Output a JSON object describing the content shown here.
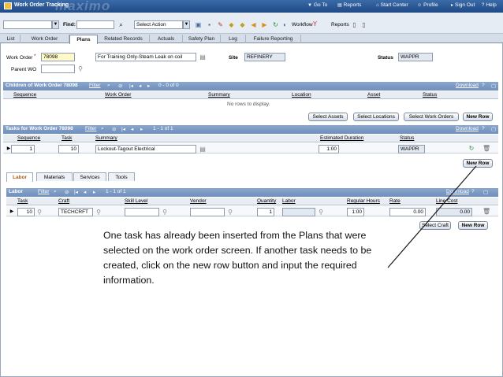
{
  "app": {
    "title": "Work Order Tracking",
    "logo": "maximo",
    "nav": [
      "Go To",
      "Reports",
      "Start Center",
      "Profile",
      "Sign Out",
      "Help"
    ]
  },
  "toolbar": {
    "find_label": "Find:",
    "select_action": "Select Action",
    "workflow_label": "Workflow",
    "reports_label": "Reports"
  },
  "tabs": [
    "List",
    "Work Order",
    "Plans",
    "Related Records",
    "Actuals",
    "Safety Plan",
    "Log",
    "Failure Reporting"
  ],
  "header": {
    "work_order_label": "Work Order",
    "work_order_value": "78098",
    "description": "For Training Only-Steam Leak on coil",
    "site_label": "Site",
    "site_value": "REFINERY",
    "status_label": "Status",
    "status_value": "WAPPR",
    "parent_label": "Parent WO",
    "parent_value": ""
  },
  "children": {
    "title": "Children of Work Order 78098",
    "filter": "Filter",
    "pager": "0 - 0 of 0",
    "download": "Download",
    "columns": [
      "Sequence",
      "Work Order",
      "Summary",
      "Location",
      "Asset",
      "Status"
    ],
    "empty": "No rows to display.",
    "buttons": [
      "Select Assets",
      "Select Locations",
      "Select Work Orders",
      "New Row"
    ]
  },
  "tasks": {
    "title": "Tasks for Work Order 78098",
    "filter": "Filter",
    "pager": "1 - 1 of 1",
    "download": "Download",
    "columns": [
      "Sequence",
      "Task",
      "Summary",
      "Estimated Duration",
      "Status"
    ],
    "row": {
      "sequence": "1",
      "task": "10",
      "summary": "Lockout-Tagout Electrical",
      "duration": "1:00",
      "status": "WAPPR"
    },
    "new_row": "New Row"
  },
  "lower_tabs": [
    "Labor",
    "Materials",
    "Services",
    "Tools"
  ],
  "labor": {
    "title": "Labor",
    "filter": "Filter",
    "pager": "1 - 1 of 1",
    "download": "Download",
    "columns": [
      "Task",
      "Craft",
      "Skill Level",
      "Vendor",
      "Quantity",
      "Labor",
      "Regular Hours",
      "Rate",
      "Line Cost"
    ],
    "row": {
      "task": "10",
      "craft": "TECHCRFT",
      "skill": "",
      "vendor": "",
      "quantity": "1",
      "labor": "",
      "hours": "1:00",
      "rate": "0.00",
      "line_cost": "0.00"
    },
    "buttons": [
      "Select Craft",
      "New Row"
    ]
  },
  "callout": "One task has already been inserted from the Plans that were selected on the work order screen.  If another task needs to be created, click on the new row button and input the required information.",
  "colors": {
    "titlebar": "#1f4a86",
    "section": "#7a98c4",
    "accent_tab": "#b0621a"
  }
}
